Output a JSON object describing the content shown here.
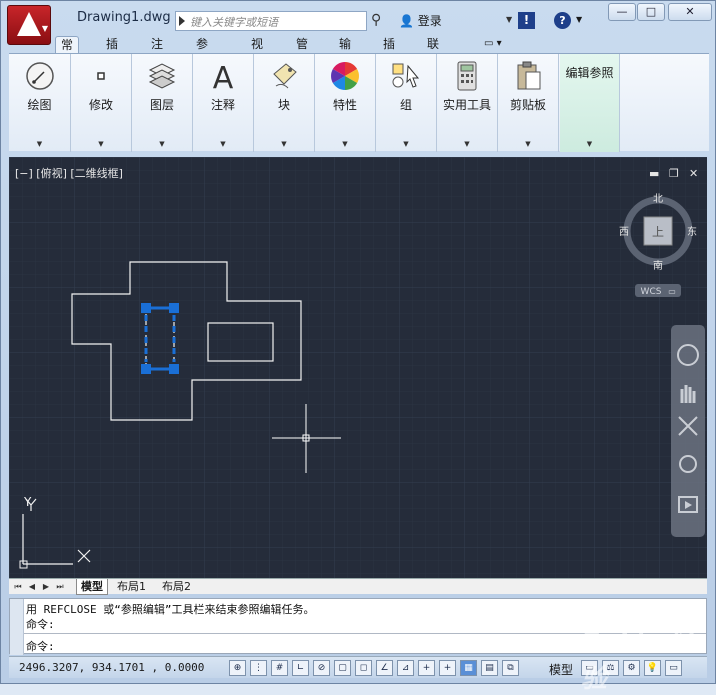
{
  "window": {
    "document_title": "Drawing1.dwg",
    "search_placeholder": "键入关键字或短语",
    "login_label": "登录",
    "exchange_icon": "!",
    "help_icon": "?",
    "minimize": "—",
    "maximize": "□",
    "close": "✕"
  },
  "ribbon": {
    "tabs": [
      "常用",
      "插入",
      "注释",
      "参数化",
      "视图",
      "管理",
      "输出",
      "插件",
      "联机"
    ],
    "active_tab": "常用",
    "panels": [
      {
        "label": "绘图",
        "icon": "draw-icon"
      },
      {
        "label": "修改",
        "icon": "modify-icon"
      },
      {
        "label": "图层",
        "icon": "layers-icon"
      },
      {
        "label": "注释",
        "icon": "annotation-icon"
      },
      {
        "label": "块",
        "icon": "block-icon"
      },
      {
        "label": "特性",
        "icon": "properties-icon"
      },
      {
        "label": "组",
        "icon": "group-icon"
      },
      {
        "label": "实用工具",
        "icon": "calculator-icon"
      },
      {
        "label": "剪贴板",
        "icon": "clipboard-icon"
      },
      {
        "label": "编辑参照",
        "icon": "edit-reference"
      }
    ]
  },
  "viewport": {
    "label": "[−] [俯视] [二维线框]",
    "viewcube": {
      "north": "北",
      "south": "南",
      "east": "东",
      "west": "西",
      "top_face": "上",
      "wcs": "WCS"
    },
    "ucs_y": "Y"
  },
  "layout_tabs": [
    "模型",
    "布局1",
    "布局2"
  ],
  "command": {
    "history": "用 REFCLOSE 或“参照编辑”工具栏来结束参照编辑任务。",
    "prompt1": "命令:",
    "prompt2": "命令:"
  },
  "status": {
    "coordinates": "2496.3207, 934.1701 , 0.0000",
    "model_label": "模型"
  },
  "colors": {
    "canvas": "#252c3a",
    "grip": "#1a6fd6",
    "ribbon_highlight": "#cdebdf"
  }
}
